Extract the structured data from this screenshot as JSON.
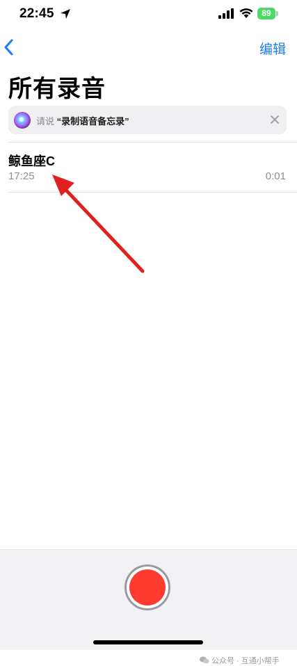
{
  "status_bar": {
    "time": "22:45",
    "battery": "89"
  },
  "nav": {
    "edit_label": "编辑"
  },
  "page": {
    "title": "所有录音"
  },
  "siri": {
    "prefix": "请说",
    "phrase": "“录制语音备忘录”"
  },
  "recordings": [
    {
      "name": "鲸鱼座C",
      "time": "17:25",
      "duration": "0:01"
    }
  ],
  "watermark": {
    "text": "公众号 · 互通小帮手"
  },
  "colors": {
    "accent": "#1a7cf5",
    "record": "#ff3b30",
    "annotation_arrow": "#e02020"
  }
}
